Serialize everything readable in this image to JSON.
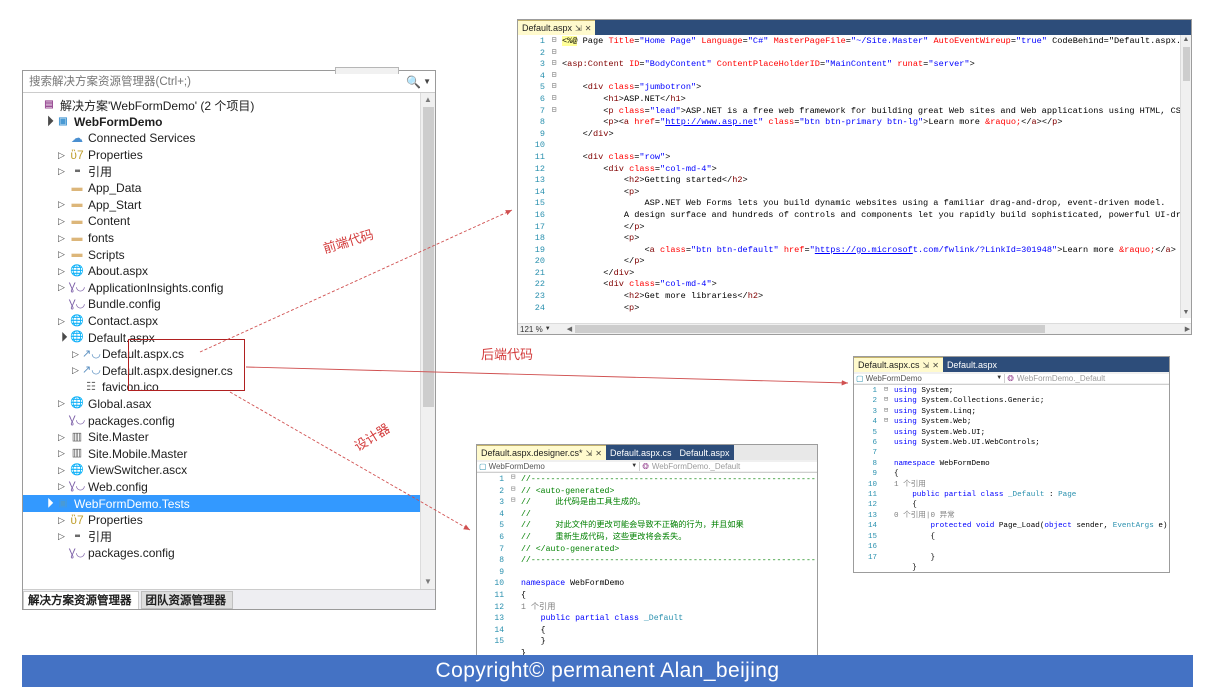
{
  "solution_explorer": {
    "search_placeholder": "搜索解决方案资源管理器(Ctrl+;)",
    "search_value": "",
    "search_icon": "search-icon",
    "tree": [
      {
        "indent": 0,
        "expander": "none",
        "icon": "solution-icon",
        "label": "解决方案'WebFormDemo' (2 个项目)",
        "bold": false,
        "selected": false
      },
      {
        "indent": 1,
        "expander": "open",
        "icon": "project-icon",
        "label": "WebFormDemo",
        "bold": true,
        "selected": false
      },
      {
        "indent": 2,
        "expander": "none",
        "icon": "cloud-icon",
        "label": "Connected Services",
        "bold": false,
        "selected": false
      },
      {
        "indent": 2,
        "expander": "closed",
        "icon": "wrench-icon",
        "label": "Properties",
        "bold": false,
        "selected": false
      },
      {
        "indent": 2,
        "expander": "closed",
        "icon": "reference-icon",
        "label": "引用",
        "bold": false,
        "selected": false
      },
      {
        "indent": 2,
        "expander": "none",
        "icon": "folder-icon",
        "label": "App_Data",
        "bold": false,
        "selected": false
      },
      {
        "indent": 2,
        "expander": "closed",
        "icon": "folder-icon",
        "label": "App_Start",
        "bold": false,
        "selected": false
      },
      {
        "indent": 2,
        "expander": "closed",
        "icon": "folder-icon",
        "label": "Content",
        "bold": false,
        "selected": false
      },
      {
        "indent": 2,
        "expander": "closed",
        "icon": "folder-icon",
        "label": "fonts",
        "bold": false,
        "selected": false
      },
      {
        "indent": 2,
        "expander": "closed",
        "icon": "folder-icon",
        "label": "Scripts",
        "bold": false,
        "selected": false
      },
      {
        "indent": 2,
        "expander": "closed",
        "icon": "aspx-icon",
        "label": "About.aspx",
        "bold": false,
        "selected": false
      },
      {
        "indent": 2,
        "expander": "closed",
        "icon": "config-icon",
        "label": "ApplicationInsights.config",
        "bold": false,
        "selected": false
      },
      {
        "indent": 2,
        "expander": "none",
        "icon": "config-icon",
        "label": "Bundle.config",
        "bold": false,
        "selected": false
      },
      {
        "indent": 2,
        "expander": "closed",
        "icon": "aspx-icon",
        "label": "Contact.aspx",
        "bold": false,
        "selected": false
      },
      {
        "indent": 2,
        "expander": "open",
        "icon": "aspx-icon",
        "label": "Default.aspx",
        "bold": false,
        "selected": false
      },
      {
        "indent": 3,
        "expander": "closed",
        "icon": "csharp-icon",
        "label": "Default.aspx.cs",
        "bold": false,
        "selected": false
      },
      {
        "indent": 3,
        "expander": "closed",
        "icon": "csharp-icon",
        "label": "Default.aspx.designer.cs",
        "bold": false,
        "selected": false
      },
      {
        "indent": 3,
        "expander": "none",
        "icon": "file-icon",
        "label": "favicon.ico",
        "bold": false,
        "selected": false
      },
      {
        "indent": 2,
        "expander": "closed",
        "icon": "global-icon",
        "label": "Global.asax",
        "bold": false,
        "selected": false
      },
      {
        "indent": 2,
        "expander": "none",
        "icon": "config-icon",
        "label": "packages.config",
        "bold": false,
        "selected": false
      },
      {
        "indent": 2,
        "expander": "closed",
        "icon": "master-icon",
        "label": "Site.Master",
        "bold": false,
        "selected": false
      },
      {
        "indent": 2,
        "expander": "closed",
        "icon": "master-icon",
        "label": "Site.Mobile.Master",
        "bold": false,
        "selected": false
      },
      {
        "indent": 2,
        "expander": "closed",
        "icon": "ascx-icon",
        "label": "ViewSwitcher.ascx",
        "bold": false,
        "selected": false
      },
      {
        "indent": 2,
        "expander": "closed",
        "icon": "config-icon",
        "label": "Web.config",
        "bold": false,
        "selected": false
      },
      {
        "indent": 1,
        "expander": "open",
        "icon": "test-project-icon",
        "label": "WebFormDemo.Tests",
        "bold": false,
        "selected": true
      },
      {
        "indent": 2,
        "expander": "closed",
        "icon": "wrench-icon",
        "label": "Properties",
        "bold": false,
        "selected": false
      },
      {
        "indent": 2,
        "expander": "closed",
        "icon": "reference-icon",
        "label": "引用",
        "bold": false,
        "selected": false
      },
      {
        "indent": 2,
        "expander": "none",
        "icon": "config-icon",
        "label": "packages.config",
        "bold": false,
        "selected": false
      }
    ],
    "tabs": [
      {
        "label": "解决方案资源管理器",
        "active": true
      },
      {
        "label": "团队资源管理器",
        "active": false
      }
    ]
  },
  "editor_aspx": {
    "tabs": [
      {
        "label": "Default.aspx",
        "active": true,
        "pin": "⇲",
        "close": "✕"
      }
    ],
    "zoom_level": "121 %",
    "line_numbers": [
      "1",
      "2",
      "3",
      "4",
      "5",
      "6",
      "7",
      "8",
      "9",
      "10",
      "11",
      "12",
      "13",
      "14",
      "15",
      "16",
      "17",
      "18",
      "19",
      "20",
      "21",
      "22",
      "23",
      "24"
    ],
    "code_lines": [
      "<%@ Page Title=\"Home Page\" Language=\"C#\" MasterPageFile=\"~/Site.Master\" AutoEventWireup=\"true\" CodeBehind=\"Default.aspx.c",
      "",
      "<asp:Content ID=\"BodyContent\" ContentPlaceHolderID=\"MainContent\" runat=\"server\">",
      "",
      "    <div class=\"jumbotron\">",
      "        <h1>ASP.NET</h1>",
      "        <p class=\"lead\">ASP.NET is a free web framework for building great Web sites and Web applications using HTML, CSS",
      "        <p><a href=\"http://www.asp.net\" class=\"btn btn-primary btn-lg\">Learn more &raquo;</a></p>",
      "    </div>",
      "",
      "    <div class=\"row\">",
      "        <div class=\"col-md-4\">",
      "            <h2>Getting started</h2>",
      "            <p>",
      "                ASP.NET Web Forms lets you build dynamic websites using a familiar drag-and-drop, event-driven model.",
      "            A design surface and hundreds of controls and components let you rapidly build sophisticated, powerful UI-dri",
      "            </p>",
      "            <p>",
      "                <a class=\"btn btn-default\" href=\"https://go.microsoft.com/fwlink/?LinkId=301948\">Learn more &raquo;</a>",
      "            </p>",
      "        </div>",
      "        <div class=\"col-md-4\">",
      "            <h2>Get more libraries</h2>",
      "            <p>"
    ]
  },
  "editor_cs": {
    "tabs": [
      {
        "label": "Default.aspx.cs",
        "active": true,
        "pin": "⇲",
        "close": "✕"
      },
      {
        "label": "Default.aspx",
        "active": false
      }
    ],
    "nav_left": "WebFormDemo",
    "nav_right": "WebFormDemo._Default",
    "line_numbers": [
      "1",
      "2",
      "3",
      "4",
      "5",
      "6",
      "7",
      "8",
      "9",
      "10",
      "11",
      "12",
      "13",
      "14",
      "15",
      "16",
      "17"
    ],
    "code_lines": [
      "using System;",
      "using System.Collections.Generic;",
      "using System.Linq;",
      "using System.Web;",
      "using System.Web.UI;",
      "using System.Web.UI.WebControls;",
      "",
      "namespace WebFormDemo",
      "{",
      "    public partial class _Default : Page",
      "    {",
      "        protected void Page_Load(object sender, EventArgs e)",
      "        {",
      "",
      "        }",
      "    }",
      "}"
    ],
    "codelens_class": "1 个引用",
    "codelens_method": "0 个引用|0 异常"
  },
  "editor_designer": {
    "tabs": [
      {
        "label": "Default.aspx.designer.cs*",
        "active": true,
        "pin": "⇲",
        "close": "✕"
      },
      {
        "label": "Default.aspx.cs",
        "active": false
      },
      {
        "label": "Default.aspx",
        "active": false
      }
    ],
    "nav_left": "WebFormDemo",
    "nav_right": "WebFormDemo._Default",
    "line_numbers": [
      "1",
      "2",
      "3",
      "4",
      "5",
      "6",
      "7",
      "8",
      "9",
      "10",
      "11",
      "12",
      "13",
      "14",
      "15"
    ],
    "code_lines": [
      "//------------------------------------------------------------",
      "// <auto-generated>",
      "//     此代码是由工具生成的。",
      "//",
      "//     对此文件的更改可能会导致不正确的行为，并且如果",
      "//     重新生成代码，这些更改将会丢失。",
      "// </auto-generated>",
      "//------------------------------------------------------------",
      "",
      "namespace WebFormDemo",
      "{",
      "    public partial class _Default",
      "    {",
      "    }",
      "}"
    ],
    "codelens_class": "1 个引用"
  },
  "annotations": [
    {
      "id": "frontend",
      "text": "前端代码"
    },
    {
      "id": "backend",
      "text": "后端代码"
    },
    {
      "id": "designer",
      "text": "设计器"
    }
  ],
  "footer": {
    "text": "Copyright© permanent  Alan_beijing",
    "background": "#4472c4",
    "color": "#ffffff"
  },
  "colors": {
    "selection_blue": "#3399ff",
    "tab_active_yellow": "#fffacd",
    "tabstrip_blue": "#2d4d7a",
    "annotation_red": "#d33b3b",
    "box_red": "#b02020",
    "gutter_teal": "#2b91af"
  }
}
